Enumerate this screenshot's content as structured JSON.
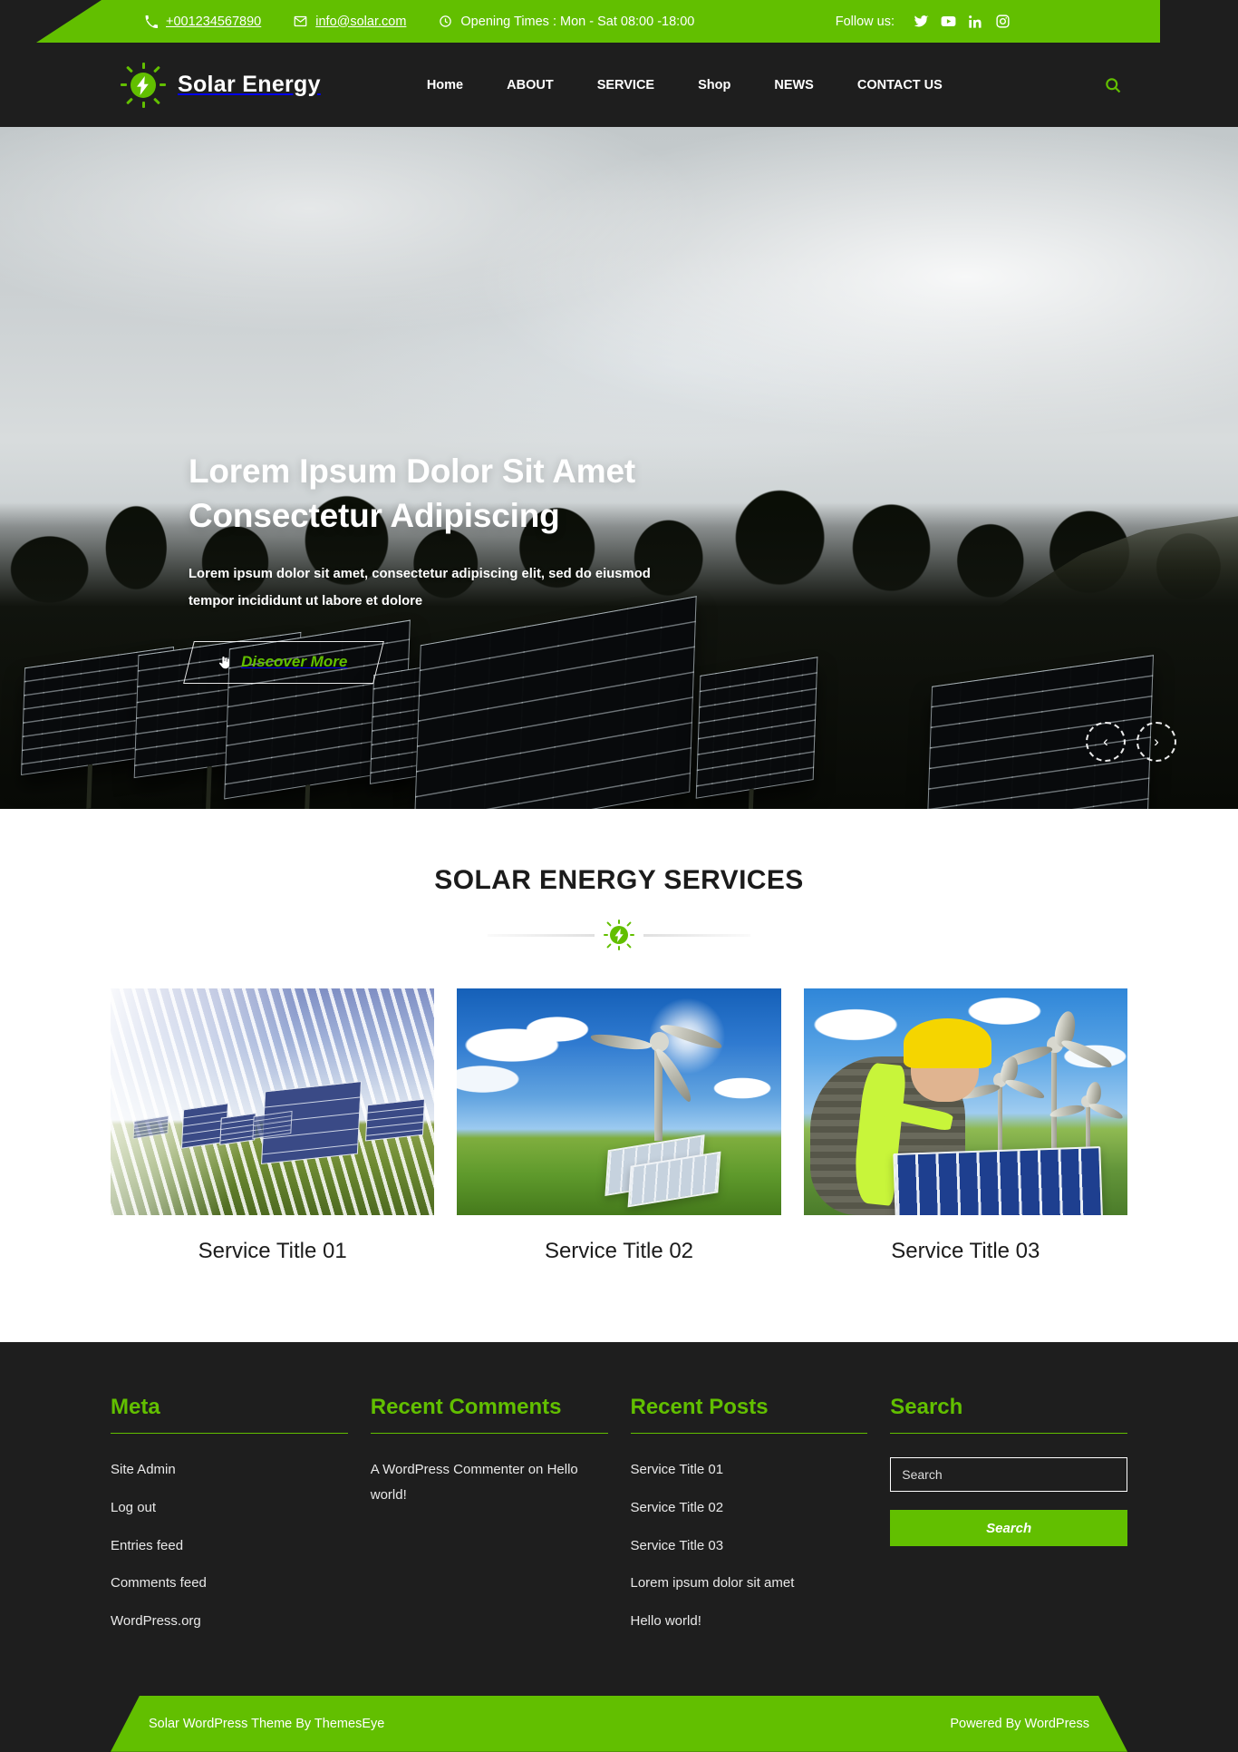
{
  "topbar": {
    "phone": "+001234567890",
    "email": "info@solar.com",
    "hours": "Opening Times : Mon - Sat 08:00 -18:00",
    "follow_label": "Follow us:",
    "social": [
      {
        "name": "twitter-icon",
        "label": "Twitter"
      },
      {
        "name": "youtube-icon",
        "label": "YouTube"
      },
      {
        "name": "linkedin-icon",
        "label": "LinkedIn"
      },
      {
        "name": "instagram-icon",
        "label": "Instagram"
      }
    ]
  },
  "header": {
    "brand": "Solar Energy",
    "nav": [
      {
        "label": "Home",
        "active": true
      },
      {
        "label": "ABOUT",
        "active": false
      },
      {
        "label": "SERVICE",
        "active": false
      },
      {
        "label": "Shop",
        "active": false
      },
      {
        "label": "NEWS",
        "active": false
      },
      {
        "label": "CONTACT US",
        "active": false
      }
    ],
    "search_icon": "search-icon"
  },
  "hero": {
    "title_line1": "Lorem Ipsum Dolor Sit Amet",
    "title_line2": "Consectetur Adipiscing",
    "subtitle_line1": "Lorem ipsum dolor sit amet, consectetur adipiscing elit, sed do eiusmod",
    "subtitle_line2": "tempor incididunt ut labore et dolore",
    "cta_label": "Discover More",
    "prev_label": "‹",
    "next_label": "›"
  },
  "services": {
    "heading": "SOLAR ENERGY SERVICES",
    "items": [
      {
        "title": "Service Title 01",
        "image": "solar-panels-in-grass-field"
      },
      {
        "title": "Service Title 02",
        "image": "wind-turbine-and-solar-panels"
      },
      {
        "title": "Service Title 03",
        "image": "worker-installing-solar-panel"
      }
    ]
  },
  "footer": {
    "widgets": {
      "meta": {
        "title": "Meta",
        "links": [
          "Site Admin",
          "Log out",
          "Entries feed",
          "Comments feed",
          "WordPress.org"
        ]
      },
      "recent_comments": {
        "title": "Recent Comments",
        "author": "A WordPress Commenter",
        "on": "on",
        "post": "Hello world!"
      },
      "recent_posts": {
        "title": "Recent Posts",
        "links": [
          "Service Title 01",
          "Service Title 02",
          "Service Title 03",
          "Lorem ipsum dolor sit amet",
          "Hello world!"
        ]
      },
      "search": {
        "title": "Search",
        "placeholder": "Search",
        "button_label": "Search"
      }
    },
    "bottom_left": "Solar WordPress Theme By ThemesEye",
    "bottom_right": "Powered By WordPress"
  },
  "colors": {
    "accent_green": "#62bf00",
    "dark": "#1e1e1e",
    "white": "#ffffff"
  }
}
